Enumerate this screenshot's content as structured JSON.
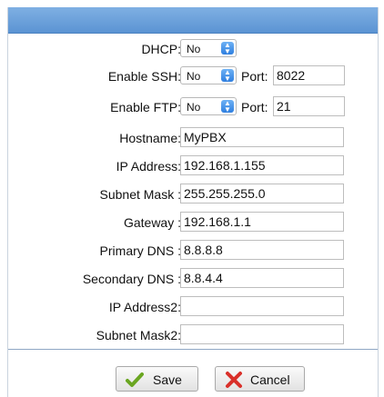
{
  "form": {
    "dhcp": {
      "label": "DHCP:",
      "value": "No"
    },
    "ssh": {
      "label": "Enable SSH:",
      "value": "No",
      "port_label": "Port:",
      "port": "8022"
    },
    "ftp": {
      "label": "Enable FTP:",
      "value": "No",
      "port_label": "Port:",
      "port": "21"
    },
    "hostname": {
      "label": "Hostname:",
      "value": "MyPBX"
    },
    "ip_address": {
      "label": "IP Address:",
      "value": "192.168.1.155"
    },
    "subnet_mask": {
      "label": "Subnet Mask :",
      "value": "255.255.255.0"
    },
    "gateway": {
      "label": "Gateway :",
      "value": "192.168.1.1"
    },
    "primary_dns": {
      "label": "Primary DNS :",
      "value": "8.8.8.8"
    },
    "secondary_dns": {
      "label": "Secondary DNS :",
      "value": "8.8.4.4"
    },
    "ip_address2": {
      "label": "IP Address2:",
      "value": ""
    },
    "subnet_mask2": {
      "label": "Subnet Mask2:",
      "value": ""
    }
  },
  "buttons": {
    "save_label": "Save",
    "cancel_label": "Cancel"
  },
  "icons": {
    "save": "checkmark-icon",
    "cancel": "red-x-icon"
  },
  "colors": {
    "titlebar": "#5b94d3",
    "select_arrow": "#2f7fe0",
    "save_check": "#6aa621",
    "cancel_x": "#d9302a"
  }
}
